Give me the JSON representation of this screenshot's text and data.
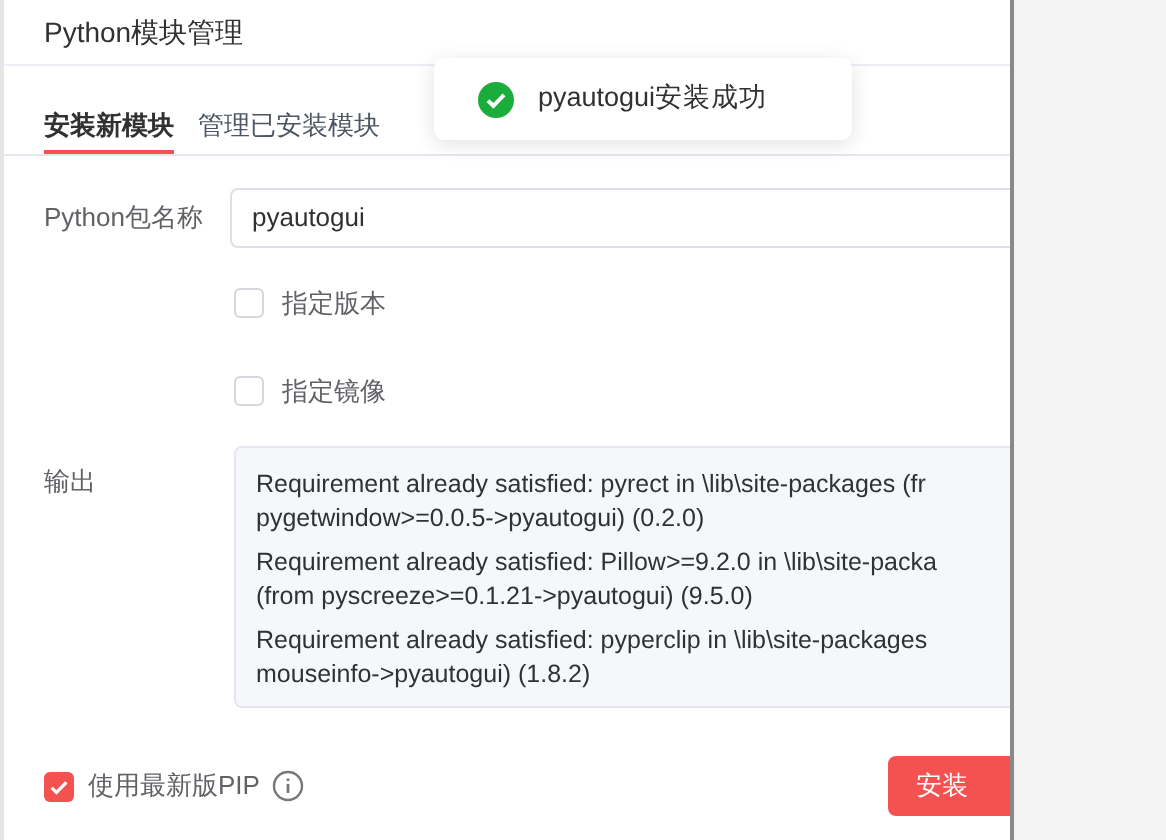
{
  "window": {
    "title": "Python模块管理"
  },
  "toast": {
    "message": "pyautogui安装成功"
  },
  "tabs": [
    {
      "label": "安装新模块",
      "selected": true
    },
    {
      "label": "管理已安装模块",
      "selected": false
    }
  ],
  "package_field": {
    "label": "Python包名称",
    "value": "pyautogui"
  },
  "options": [
    {
      "label": "指定版本",
      "checked": false
    },
    {
      "label": "指定镜像",
      "checked": false
    }
  ],
  "output": {
    "label": "输出",
    "lines": [
      "Requirement already satisfied: pyrect in \\lib\\site-packages (fr",
      "pygetwindow>=0.0.5->pyautogui) (0.2.0)",
      "Requirement already satisfied: Pillow>=9.2.0 in \\lib\\site-packa",
      "(from pyscreeze>=0.1.21->pyautogui) (9.5.0)",
      "Requirement already satisfied: pyperclip in \\lib\\site-packages",
      "mouseinfo->pyautogui) (1.8.2)"
    ]
  },
  "latest_pip": {
    "label": "使用最新版PIP",
    "checked": true
  },
  "install_button": "安装"
}
